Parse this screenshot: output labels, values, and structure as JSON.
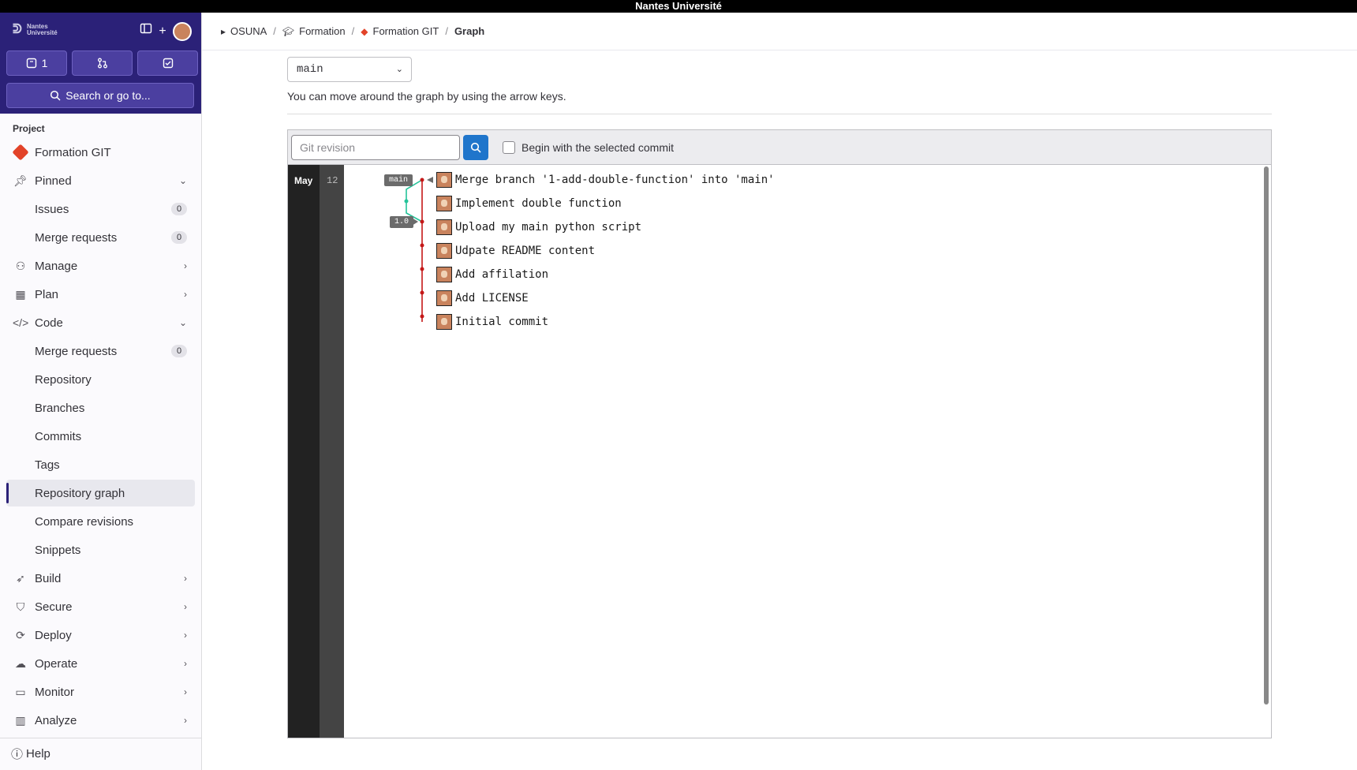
{
  "window_title": "Nantes Université",
  "sidebar": {
    "logo_text": "Nantes Université",
    "counts": {
      "issues": "1"
    },
    "search_label": "Search or go to...",
    "section_title": "Project",
    "project_name": "Formation GIT",
    "items": [
      {
        "label": "Pinned"
      },
      {
        "label": "Issues",
        "badge": "0"
      },
      {
        "label": "Merge requests",
        "badge": "0"
      },
      {
        "label": "Manage"
      },
      {
        "label": "Plan"
      },
      {
        "label": "Code"
      },
      {
        "label": "Merge requests",
        "badge": "0"
      },
      {
        "label": "Repository"
      },
      {
        "label": "Branches"
      },
      {
        "label": "Commits"
      },
      {
        "label": "Tags"
      },
      {
        "label": "Repository graph"
      },
      {
        "label": "Compare revisions"
      },
      {
        "label": "Snippets"
      },
      {
        "label": "Build"
      },
      {
        "label": "Secure"
      },
      {
        "label": "Deploy"
      },
      {
        "label": "Operate"
      },
      {
        "label": "Monitor"
      },
      {
        "label": "Analyze"
      }
    ],
    "help_label": "Help"
  },
  "breadcrumb": [
    "OSUNA",
    "Formation",
    "Formation GIT",
    "Graph"
  ],
  "ref_selector": {
    "value": "main"
  },
  "hint": "You can move around the graph by using the arrow keys.",
  "graph": {
    "revision_placeholder": "Git revision",
    "begin_label": "Begin with the selected commit",
    "month": "May",
    "day": "12",
    "tags": {
      "branch": "main",
      "version": "1.0"
    },
    "commits": [
      "Merge branch '1-add-double-function' into 'main'",
      "Implement double function",
      "Upload my main python script",
      "Udpate README content",
      "Add affilation",
      "Add LICENSE",
      "Initial commit"
    ]
  },
  "colors": {
    "sidebar_header": "#2b2178",
    "primary_button": "#1f75cb",
    "graph_main_line": "#c41818",
    "graph_branch_line": "#24c399"
  }
}
